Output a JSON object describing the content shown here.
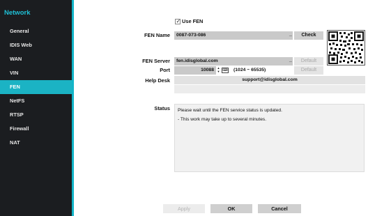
{
  "sidebar": {
    "title": "Network",
    "items": [
      {
        "label": "General",
        "active": false
      },
      {
        "label": "IDIS Web",
        "active": false
      },
      {
        "label": "WAN",
        "active": false
      },
      {
        "label": "VIN",
        "active": false
      },
      {
        "label": "FEN",
        "active": true
      },
      {
        "label": "NetFS",
        "active": false
      },
      {
        "label": "RTSP",
        "active": false
      },
      {
        "label": "Firewall",
        "active": false
      },
      {
        "label": "NAT",
        "active": false
      }
    ]
  },
  "fen": {
    "use_fen_label": "Use FEN",
    "use_fen_checked": true,
    "name_label": "FEN Name",
    "name_value": "0087-073-086",
    "check_button": "Check",
    "server_label": "FEN Server",
    "server_value": "fen.idisglobal.com",
    "default_label": "Default",
    "port_label": "Port",
    "port_value": "10088",
    "port_range": "(1024 ~ 65535)",
    "port_default_label": "Default",
    "helpdesk_label": "Help Desk",
    "helpdesk_value": "support@idisglobal.com",
    "helpdesk_extra": "",
    "dash": "_",
    "status_label": "Status",
    "status_lines": [
      "Please wait until the FEN service status is updated.",
      "- This work may take up to several minutes."
    ],
    "qr_icon": "qr-code-icon"
  },
  "footer": {
    "apply": "Apply",
    "ok": "OK",
    "cancel": "Cancel"
  },
  "colors": {
    "sidebar_bg": "#1b1d20",
    "accent": "#12b5c8",
    "active_item": "#1bb3c4"
  }
}
